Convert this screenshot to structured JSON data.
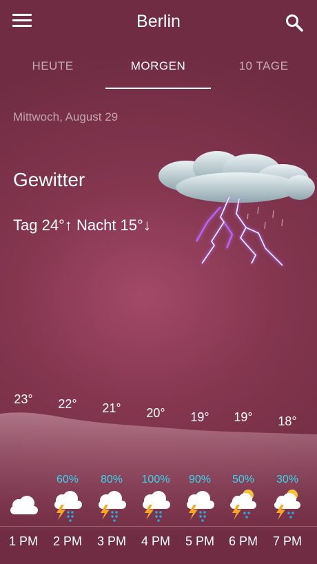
{
  "header": {
    "title": "Berlin",
    "menu_icon": "hamburger-menu-icon",
    "search_icon": "search-icon"
  },
  "tabs": [
    {
      "label": "HEUTE",
      "active": false
    },
    {
      "label": "MORGEN",
      "active": true
    },
    {
      "label": "10 TAGE",
      "active": false
    }
  ],
  "day": {
    "date": "Mittwoch, August 29",
    "condition": "Gewitter",
    "temps": "Tag 24°↑  Nacht 15°↓",
    "icon": "thunderstorm-cloud-icon"
  },
  "hourly": [
    {
      "hour": "1 PM",
      "temp": "23°",
      "precip": "",
      "icon": "cloudy-icon"
    },
    {
      "hour": "2 PM",
      "temp": "22°",
      "precip": "60%",
      "icon": "thunder-rain-icon"
    },
    {
      "hour": "3 PM",
      "temp": "21°",
      "precip": "80%",
      "icon": "thunder-rain-icon"
    },
    {
      "hour": "4 PM",
      "temp": "20°",
      "precip": "100%",
      "icon": "thunder-rain-icon"
    },
    {
      "hour": "5 PM",
      "temp": "19°",
      "precip": "90%",
      "icon": "thunder-rain-icon"
    },
    {
      "hour": "6 PM",
      "temp": "19°",
      "precip": "50%",
      "icon": "sun-thunder-rain-icon"
    },
    {
      "hour": "7 PM",
      "temp": "18°",
      "precip": "30%",
      "icon": "sun-thunder-rain-icon"
    }
  ],
  "colors": {
    "background": "#84364f",
    "precip": "#36d7ee",
    "bolt": "#f6a623",
    "rain": "#2aa8e0"
  }
}
